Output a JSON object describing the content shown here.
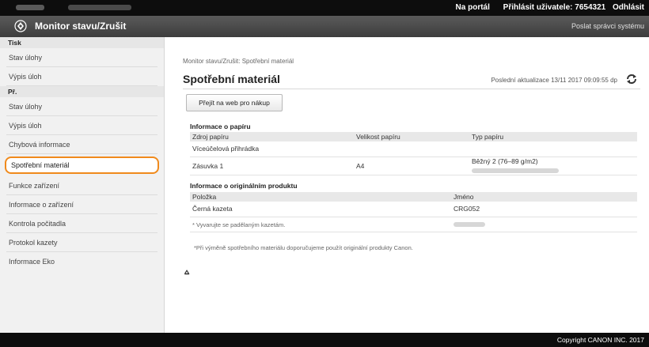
{
  "topbar": {
    "portal_link": "Na portál",
    "login_label": "Přihlásit uživatele: 7654321",
    "logout_link": "Odhlásit"
  },
  "titlebar": {
    "title": "Monitor stavu/Zrušit",
    "admin_link": "Poslat správci systému"
  },
  "sidebar": {
    "sections": [
      {
        "heading": "Tisk",
        "items": [
          "Stav úlohy",
          "Výpis úloh"
        ]
      },
      {
        "heading": "Př.",
        "items": [
          "Stav úlohy",
          "Výpis úloh"
        ]
      }
    ],
    "other_items": [
      "Chybová informace",
      "Spotřební materiál",
      "Funkce zařízení",
      "Informace o zařízení",
      "Kontrola počitadla",
      "Protokol kazety",
      "Informace Eko"
    ],
    "active_item": "Spotřební materiál"
  },
  "main": {
    "breadcrumb": "Monitor stavu/Zrušit: Spotřební materiál",
    "title": "Spotřební materiál",
    "last_update": "Poslední aktualizace 13/11 2017 09:09:55 dp",
    "web_button": "Přejít na web pro nákup",
    "paper": {
      "heading": "Informace o papíru",
      "columns": [
        "Zdroj papíru",
        "Velikost papíru",
        "Typ papíru"
      ],
      "rows": [
        [
          "Víceúčelová přihrádka",
          "",
          ""
        ],
        [
          "Zásuvka 1",
          "A4",
          "Běžný 2 (76–89 g/m2)"
        ]
      ]
    },
    "original": {
      "heading": "Informace o originálním produktu",
      "columns": [
        "Položka",
        "Jméno"
      ],
      "rows": [
        [
          "Černá kazeta",
          "CRG052"
        ]
      ],
      "note1": "* Vyvarujte se padělaným kazetám.",
      "note2": "*Při výměně spotřebního materiálu doporučujeme použít originální produkty Canon."
    },
    "top_anchor": "⩟"
  },
  "footer": {
    "copyright": "Copyright CANON INC. 2017"
  }
}
